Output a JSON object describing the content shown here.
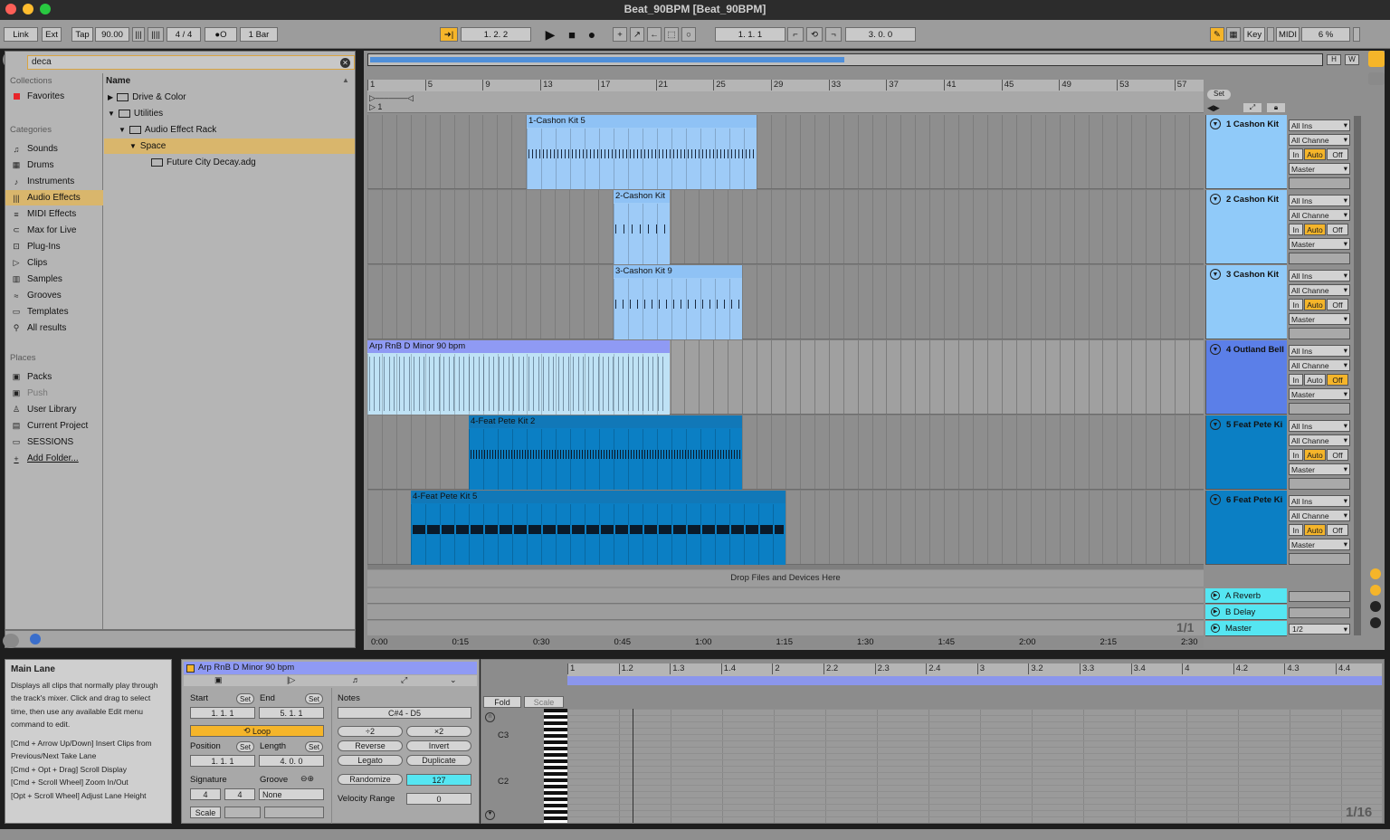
{
  "window": {
    "title": "Beat_90BPM  [Beat_90BPM]"
  },
  "controlbar": {
    "link": "Link",
    "ext": "Ext",
    "tap": "Tap",
    "tempo": "90.00",
    "signature": "4  /  4",
    "metro": "●O",
    "quantize": "1 Bar",
    "arr_pos": "1.   2.   2",
    "loop_start": "1.   1.   1",
    "loop_len": "3.   0.   0",
    "key": "Key",
    "midi": "MIDI",
    "cpu": "6 %"
  },
  "browser": {
    "search": "deca",
    "collections_label": "Collections",
    "favorites": "Favorites",
    "categories_label": "Categories",
    "categories": [
      {
        "label": "Sounds",
        "icon": "sounds-icon",
        "glyph": "♫"
      },
      {
        "label": "Drums",
        "icon": "drums-icon",
        "glyph": "▦"
      },
      {
        "label": "Instruments",
        "icon": "instruments-icon",
        "glyph": "♪"
      },
      {
        "label": "Audio Effects",
        "icon": "audio-effects-icon",
        "glyph": "|||"
      },
      {
        "label": "MIDI Effects",
        "icon": "midi-effects-icon",
        "glyph": "≡"
      },
      {
        "label": "Max for Live",
        "icon": "max-for-live-icon",
        "glyph": "⊂"
      },
      {
        "label": "Plug-Ins",
        "icon": "plugins-icon",
        "glyph": "⊡"
      },
      {
        "label": "Clips",
        "icon": "clips-icon",
        "glyph": "▷"
      },
      {
        "label": "Samples",
        "icon": "samples-icon",
        "glyph": "▥"
      },
      {
        "label": "Grooves",
        "icon": "grooves-icon",
        "glyph": "≈"
      },
      {
        "label": "Templates",
        "icon": "templates-icon",
        "glyph": "▭"
      },
      {
        "label": "All results",
        "icon": "search-icon",
        "glyph": "⚲"
      }
    ],
    "places_label": "Places",
    "places": [
      {
        "label": "Packs",
        "icon": "packs-icon",
        "glyph": "▣"
      },
      {
        "label": "Push",
        "icon": "push-icon",
        "glyph": "▣"
      },
      {
        "label": "User Library",
        "icon": "user-icon",
        "glyph": "♙"
      },
      {
        "label": "Current Project",
        "icon": "project-icon",
        "glyph": "▤"
      },
      {
        "label": "SESSIONS",
        "icon": "folder-icon",
        "glyph": "▭"
      },
      {
        "label": "Add Folder...",
        "icon": "add-folder-icon",
        "glyph": "+"
      }
    ],
    "name_header": "Name",
    "tree": [
      "Drive & Color",
      "Utilities",
      "Audio Effect Rack",
      "Space",
      "Future City Decay.adg"
    ]
  },
  "arrangement": {
    "bars": [
      "1",
      "5",
      "9",
      "13",
      "17",
      "21",
      "25",
      "29",
      "33",
      "37",
      "41",
      "45",
      "49",
      "53",
      "57"
    ],
    "loop_start_marker": "1",
    "tracks": [
      {
        "name": "1 Cashon Kit",
        "color": "#90caf9"
      },
      {
        "name": "2 Cashon Kit",
        "color": "#90caf9"
      },
      {
        "name": "3 Cashon Kit",
        "color": "#90caf9"
      },
      {
        "name": "4 Outland Bell",
        "color": "#5b7fe8"
      },
      {
        "name": "5 Feat Pete Ki",
        "color": "#0b7fc4"
      },
      {
        "name": "6 Feat Pete Ki",
        "color": "#0b7fc4"
      }
    ],
    "clips": [
      {
        "name": "1-Cashon Kit 5"
      },
      {
        "name": "2-Cashon Kit"
      },
      {
        "name": "3-Cashon Kit 9"
      },
      {
        "name": "Arp RnB D Minor 90 bpm"
      },
      {
        "name": "4-Feat Pete Kit 2"
      },
      {
        "name": "4-Feat Pete Kit 5"
      }
    ],
    "io": {
      "in_type": "All Ins",
      "in_chan": "All Channe",
      "monitor": [
        "In",
        "Auto",
        "Off"
      ],
      "out": "Master"
    },
    "drop_hint": "Drop Files and Devices Here",
    "returns": [
      {
        "name": "A Reverb"
      },
      {
        "name": "B Delay"
      },
      {
        "name": "Master"
      }
    ],
    "master_out": "1/2",
    "set_label": "Set",
    "zoom_grid": "1/1",
    "time_marks": [
      "0:00",
      "0:15",
      "0:30",
      "0:45",
      "1:00",
      "1:15",
      "1:30",
      "1:45",
      "2:00",
      "2:15",
      "2:30"
    ]
  },
  "info": {
    "title": "Main Lane",
    "text": "Displays all clips that normally play through the track's mixer. Click and drag to select time, then use any available Edit menu command to edit.",
    "shortcuts": [
      "[Cmd + Arrow Up/Down] Insert Clips from Previous/Next Take Lane",
      "[Cmd + Opt + Drag] Scroll Display",
      "[Cmd + Scroll Wheel] Zoom In/Out",
      "[Opt + Scroll Wheel] Adjust Lane Height"
    ]
  },
  "clipview": {
    "title": "Arp RnB D Minor 90 bpm",
    "start_label": "Start",
    "end_label": "End",
    "set": "Set",
    "start": "1.    1.    1",
    "end": "5.    1.    1",
    "loop": "Loop",
    "position_label": "Position",
    "length_label": "Length",
    "position": "1.    1.    1",
    "length": "4.    0.    0",
    "signature_label": "Signature",
    "groove_label": "Groove",
    "sig_num": "4",
    "sig_den": "4",
    "groove": "None",
    "scale": "Scale",
    "notes_label": "Notes",
    "range": "C#4 - D5",
    "div2": "÷2",
    "mul2": "×2",
    "reverse": "Reverse",
    "invert": "Invert",
    "legato": "Legato",
    "duplicate": "Duplicate",
    "randomize": "Randomize",
    "randomize_val": "127",
    "velocity_range_label": "Velocity Range",
    "velocity_range": "0"
  },
  "noteeditor": {
    "fold": "Fold",
    "scale": "Scale",
    "ruler": [
      "1",
      "1.2",
      "1.3",
      "1.4",
      "2",
      "2.2",
      "2.3",
      "2.4",
      "3",
      "3.2",
      "3.3",
      "3.4",
      "4",
      "4.2",
      "4.3",
      "4.4"
    ],
    "c3": "C3",
    "c2": "C2",
    "grid": "1/16"
  }
}
